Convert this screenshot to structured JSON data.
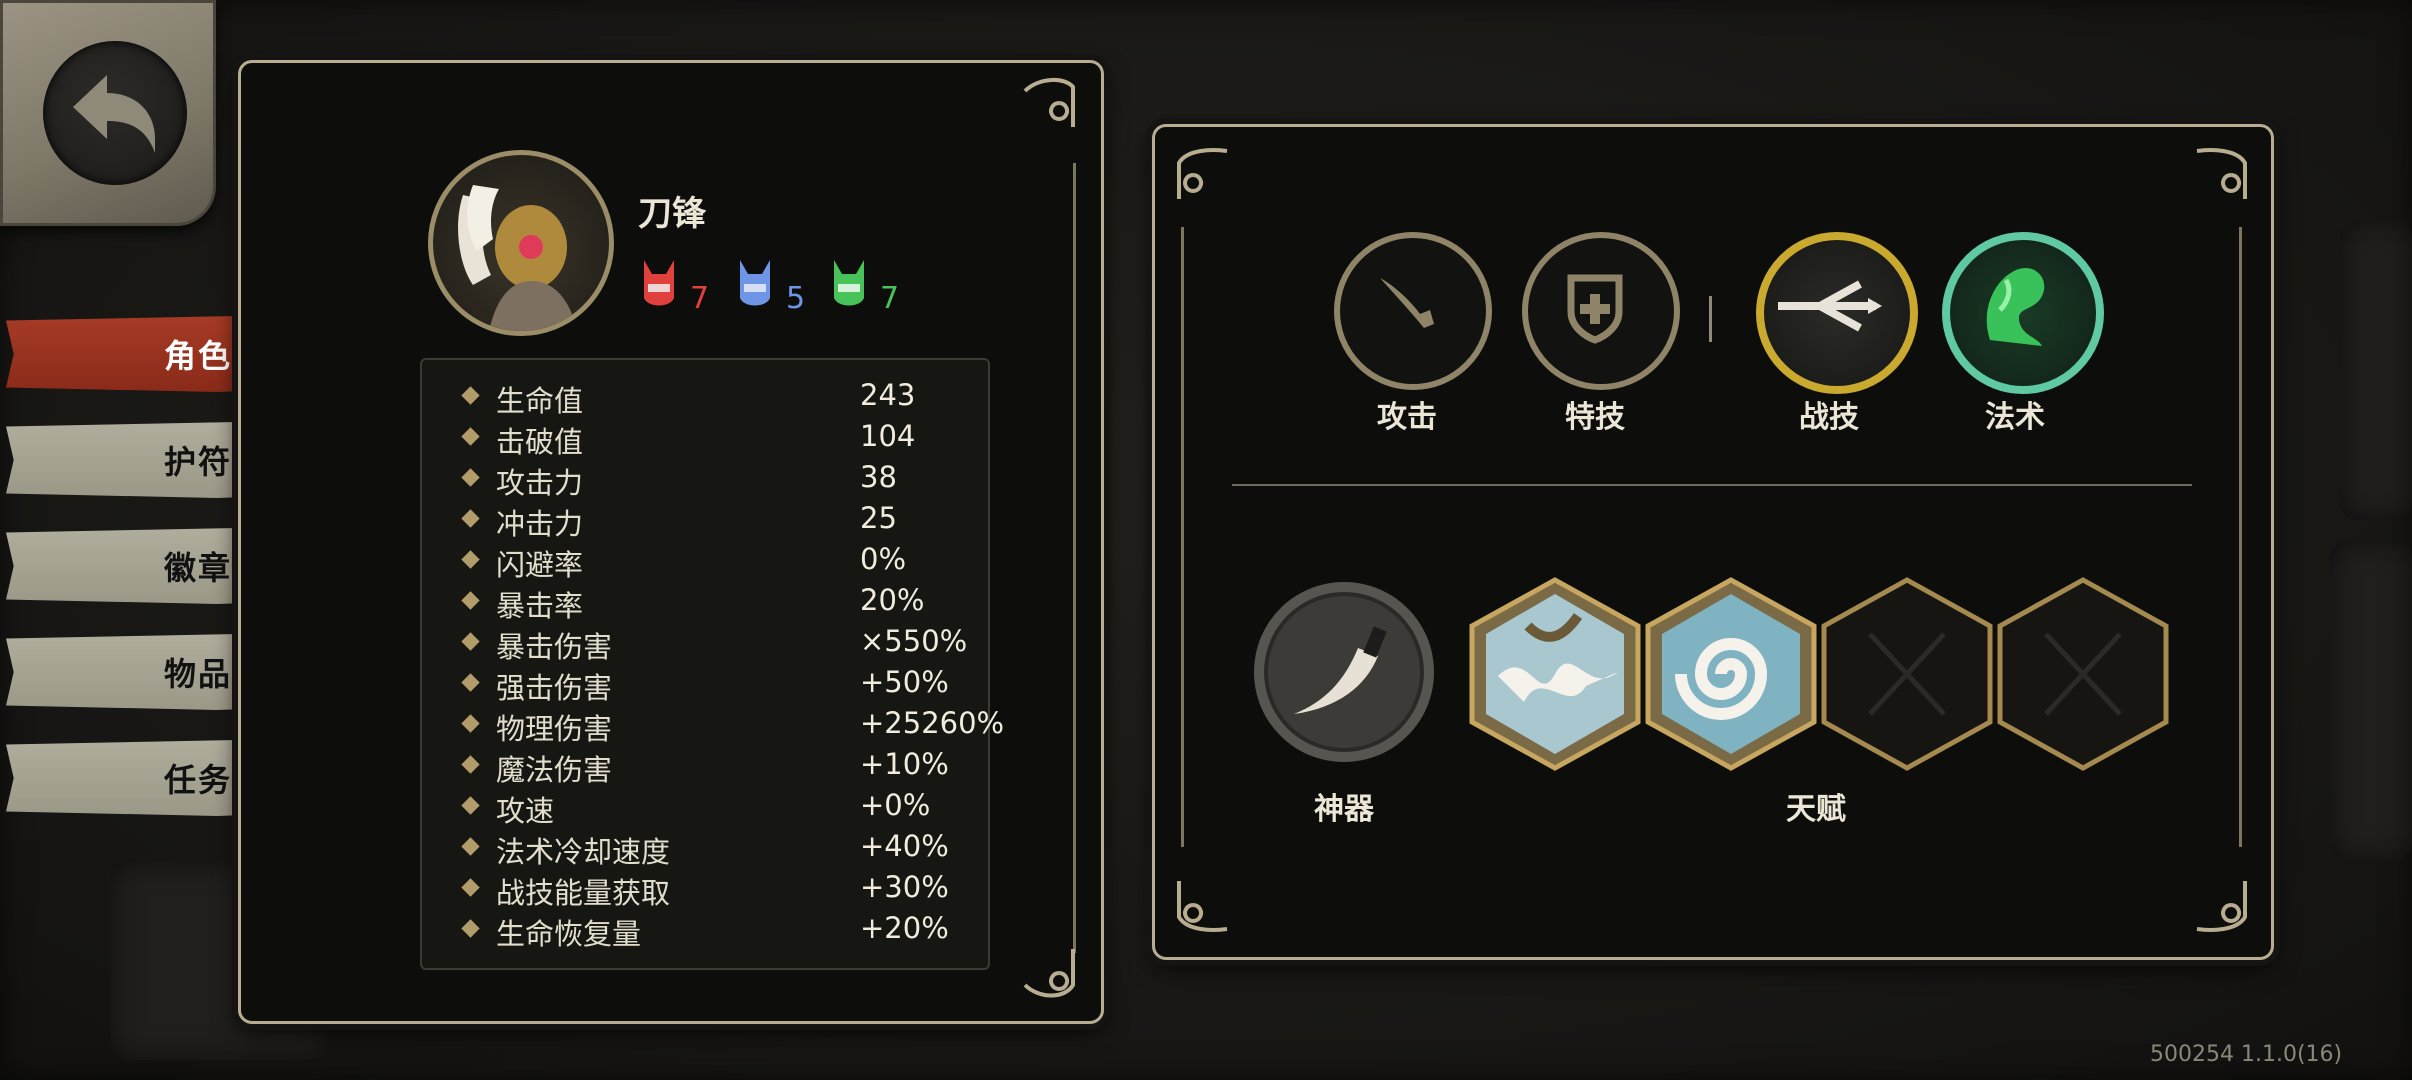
{
  "tabs": [
    {
      "label": "角色",
      "active": true
    },
    {
      "label": "护符",
      "active": false
    },
    {
      "label": "徽章",
      "active": false
    },
    {
      "label": "物品",
      "active": false
    },
    {
      "label": "任务",
      "active": false
    }
  ],
  "character": {
    "name": "刀锋",
    "masks": [
      {
        "color": "#e0413c",
        "count": "7",
        "icon": "red-mask-icon"
      },
      {
        "color": "#6f95e6",
        "count": "5",
        "icon": "blue-mask-icon"
      },
      {
        "color": "#47c35a",
        "count": "7",
        "icon": "green-mask-icon"
      }
    ]
  },
  "stats": [
    {
      "label": "生命值",
      "value": "243"
    },
    {
      "label": "击破值",
      "value": "104"
    },
    {
      "label": "攻击力",
      "value": "38"
    },
    {
      "label": "冲击力",
      "value": "25"
    },
    {
      "label": "闪避率",
      "value": "0%"
    },
    {
      "label": "暴击率",
      "value": "20%"
    },
    {
      "label": "暴击伤害",
      "value": "×550%"
    },
    {
      "label": "强击伤害",
      "value": "+50%"
    },
    {
      "label": "物理伤害",
      "value": "+25260%"
    },
    {
      "label": "魔法伤害",
      "value": "+10%"
    },
    {
      "label": "攻速",
      "value": "+0%"
    },
    {
      "label": "法术冷却速度",
      "value": "+40%"
    },
    {
      "label": "战技能量获取",
      "value": "+30%"
    },
    {
      "label": "生命恢复量",
      "value": "+20%"
    }
  ],
  "skills": [
    {
      "label": "攻击",
      "icon": "sword-icon"
    },
    {
      "label": "特技",
      "icon": "shield-icon"
    },
    {
      "label": "战技",
      "icon": "trident-icon"
    },
    {
      "label": "法术",
      "icon": "green-spirit-icon"
    }
  ],
  "artifact_label": "神器",
  "talent_label": "天赋",
  "version": "500254 1.1.0(16)"
}
